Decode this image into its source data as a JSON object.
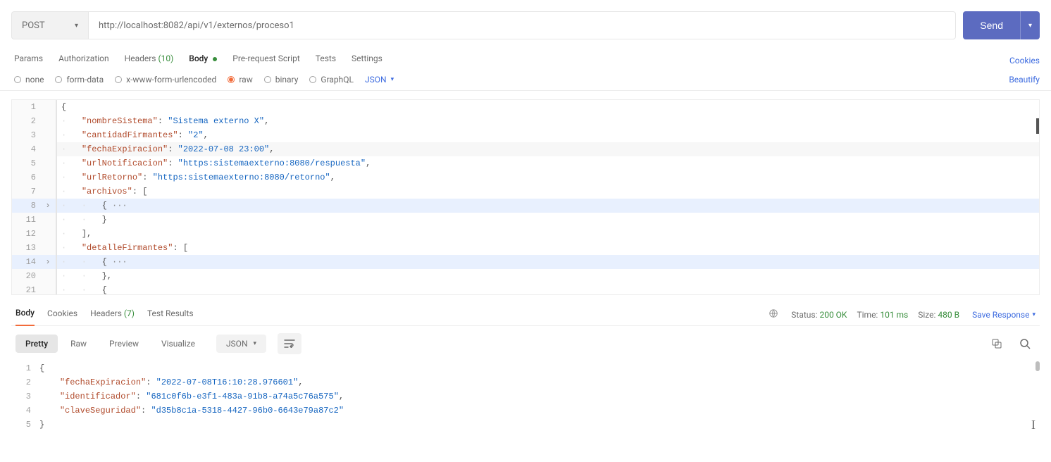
{
  "request": {
    "method": "POST",
    "url": "http://localhost:8082/api/v1/externos/proceso1",
    "send_label": "Send",
    "tabs": {
      "params": "Params",
      "authorization": "Authorization",
      "headers_label": "Headers",
      "headers_count": "(10)",
      "body": "Body",
      "prerequest": "Pre-request Script",
      "tests": "Tests",
      "settings": "Settings"
    },
    "cookies_link": "Cookies",
    "body_types": {
      "none": "none",
      "formdata": "form-data",
      "xwww": "x-www-form-urlencoded",
      "raw": "raw",
      "binary": "binary",
      "graphql": "GraphQL",
      "raw_format": "JSON"
    },
    "beautify": "Beautify"
  },
  "request_body": {
    "lines": [
      {
        "n": "1",
        "fold": "",
        "indent": "",
        "code": [
          {
            "t": "punc",
            "v": "{"
          }
        ]
      },
      {
        "n": "2",
        "fold": "",
        "indent": "    ",
        "code": [
          {
            "t": "key",
            "v": "\"nombreSistema\""
          },
          {
            "t": "punc",
            "v": ": "
          },
          {
            "t": "str",
            "v": "\"Sistema externo X\""
          },
          {
            "t": "punc",
            "v": ","
          }
        ]
      },
      {
        "n": "3",
        "fold": "",
        "indent": "    ",
        "code": [
          {
            "t": "key",
            "v": "\"cantidadFirmantes\""
          },
          {
            "t": "punc",
            "v": ": "
          },
          {
            "t": "str",
            "v": "\"2\""
          },
          {
            "t": "punc",
            "v": ","
          }
        ]
      },
      {
        "n": "4",
        "fold": "",
        "indent": "    ",
        "code": [
          {
            "t": "key",
            "v": "\"fechaExpiracion\""
          },
          {
            "t": "punc",
            "v": ": "
          },
          {
            "t": "str",
            "v": "\"2022-07-08 23:00\""
          },
          {
            "t": "punc",
            "v": ","
          }
        ],
        "cursor": true
      },
      {
        "n": "5",
        "fold": "",
        "indent": "    ",
        "code": [
          {
            "t": "key",
            "v": "\"urlNotificacion\""
          },
          {
            "t": "punc",
            "v": ": "
          },
          {
            "t": "str",
            "v": "\"https:sistemaexterno:8080/respuesta\""
          },
          {
            "t": "punc",
            "v": ","
          }
        ]
      },
      {
        "n": "6",
        "fold": "",
        "indent": "    ",
        "code": [
          {
            "t": "key",
            "v": "\"urlRetorno\""
          },
          {
            "t": "punc",
            "v": ": "
          },
          {
            "t": "str",
            "v": "\"https:sistemaexterno:8080/retorno\""
          },
          {
            "t": "punc",
            "v": ","
          }
        ]
      },
      {
        "n": "7",
        "fold": "",
        "indent": "    ",
        "code": [
          {
            "t": "key",
            "v": "\"archivos\""
          },
          {
            "t": "punc",
            "v": ": ["
          }
        ]
      },
      {
        "n": "8",
        "fold": "›",
        "indent": "        ",
        "code": [
          {
            "t": "punc",
            "v": "{"
          },
          {
            "t": "ell",
            "v": " ··· "
          }
        ],
        "hl": true
      },
      {
        "n": "11",
        "fold": "",
        "indent": "        ",
        "code": [
          {
            "t": "punc",
            "v": "}"
          }
        ]
      },
      {
        "n": "12",
        "fold": "",
        "indent": "    ",
        "code": [
          {
            "t": "punc",
            "v": "],"
          }
        ]
      },
      {
        "n": "13",
        "fold": "",
        "indent": "    ",
        "code": [
          {
            "t": "key",
            "v": "\"detalleFirmantes\""
          },
          {
            "t": "punc",
            "v": ": ["
          }
        ]
      },
      {
        "n": "14",
        "fold": "›",
        "indent": "        ",
        "code": [
          {
            "t": "punc",
            "v": "{"
          },
          {
            "t": "ell",
            "v": " ··· "
          }
        ],
        "hl": true
      },
      {
        "n": "20",
        "fold": "",
        "indent": "        ",
        "code": [
          {
            "t": "punc",
            "v": "},"
          }
        ]
      },
      {
        "n": "21",
        "fold": "",
        "indent": "        ",
        "code": [
          {
            "t": "punc",
            "v": "{"
          }
        ]
      }
    ]
  },
  "response": {
    "tabs": {
      "body": "Body",
      "cookies": "Cookies",
      "headers_label": "Headers",
      "headers_count": "(7)",
      "test_results": "Test Results"
    },
    "status": {
      "status_label": "Status:",
      "status_value": "200 OK",
      "time_label": "Time:",
      "time_value": "101 ms",
      "size_label": "Size:",
      "size_value": "480 B"
    },
    "save_response": "Save Response",
    "views": {
      "pretty": "Pretty",
      "raw": "Raw",
      "preview": "Preview",
      "visualize": "Visualize",
      "format": "JSON"
    },
    "body_lines": [
      {
        "n": "1",
        "indent": "",
        "code": [
          {
            "t": "punc",
            "v": "{"
          }
        ]
      },
      {
        "n": "2",
        "indent": "    ",
        "code": [
          {
            "t": "key",
            "v": "\"fechaExpiracion\""
          },
          {
            "t": "punc",
            "v": ": "
          },
          {
            "t": "str",
            "v": "\"2022-07-08T16:10:28.976601\""
          },
          {
            "t": "punc",
            "v": ","
          }
        ]
      },
      {
        "n": "3",
        "indent": "    ",
        "code": [
          {
            "t": "key",
            "v": "\"identificador\""
          },
          {
            "t": "punc",
            "v": ": "
          },
          {
            "t": "str",
            "v": "\"681c0f6b-e3f1-483a-91b8-a74a5c76a575\""
          },
          {
            "t": "punc",
            "v": ","
          }
        ]
      },
      {
        "n": "4",
        "indent": "    ",
        "code": [
          {
            "t": "key",
            "v": "\"claveSeguridad\""
          },
          {
            "t": "punc",
            "v": ": "
          },
          {
            "t": "str",
            "v": "\"d35b8c1a-5318-4427-96b0-6643e79a87c2\""
          }
        ]
      },
      {
        "n": "5",
        "indent": "",
        "code": [
          {
            "t": "punc",
            "v": "}"
          }
        ]
      }
    ]
  }
}
